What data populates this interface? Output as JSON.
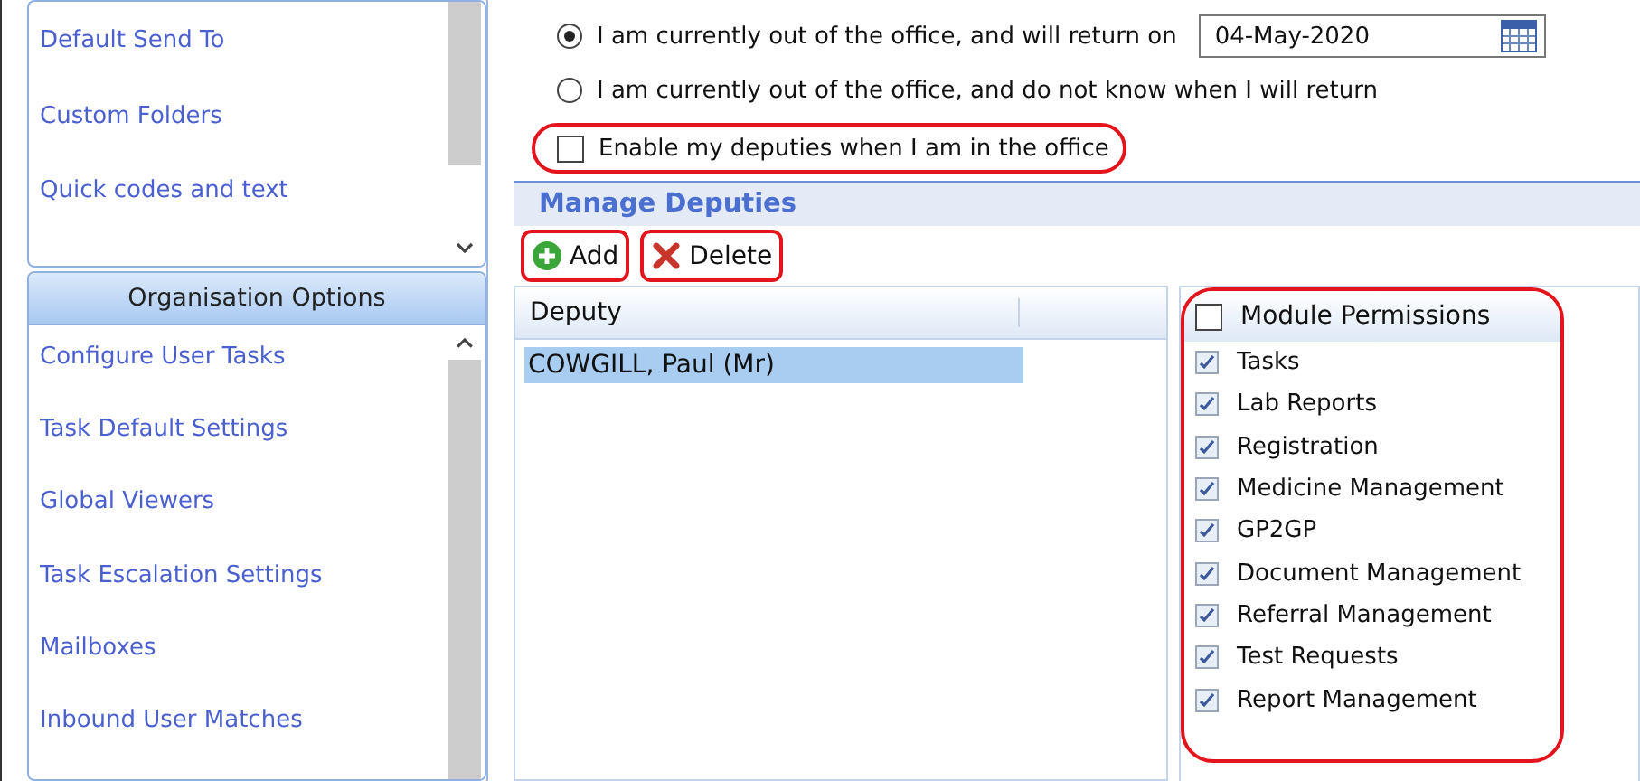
{
  "sidebar": {
    "sections": [
      {
        "items": [
          {
            "label": "Default Send To"
          },
          {
            "label": "Custom Folders"
          },
          {
            "label": "Quick codes and text"
          }
        ]
      },
      {
        "title": "Organisation Options",
        "items": [
          {
            "label": "Configure User Tasks"
          },
          {
            "label": "Task Default Settings"
          },
          {
            "label": "Global Viewers"
          },
          {
            "label": "Task Escalation Settings"
          },
          {
            "label": "Mailboxes"
          },
          {
            "label": "Inbound User Matches"
          }
        ]
      }
    ]
  },
  "return_options": [
    {
      "label": "I am currently out of the office, and will return on",
      "selected": true,
      "date": "04-May-2020"
    },
    {
      "label": "I am currently out of the office, and do not know when I will return",
      "selected": false
    }
  ],
  "enable_deputies": {
    "label": "Enable my deputies when I am in the office",
    "checked": false,
    "highlighted": true
  },
  "manage_deputies": {
    "title": "Manage Deputies",
    "buttons": [
      {
        "label": "Add",
        "kind": "add",
        "highlighted": true
      },
      {
        "label": "Delete",
        "kind": "delete",
        "highlighted": true
      }
    ]
  },
  "deputies_table": {
    "columns": [
      "Deputy"
    ],
    "rows": [
      {
        "name": "COWGILL, Paul (Mr)",
        "selected": true
      }
    ]
  },
  "permissions": {
    "highlighted": true,
    "header": {
      "label": "Module Permissions",
      "checked": false
    },
    "items": [
      {
        "label": "Tasks",
        "checked": true
      },
      {
        "label": "Lab Reports",
        "checked": true
      },
      {
        "label": "Registration",
        "checked": true
      },
      {
        "label": "Medicine Management",
        "checked": true
      },
      {
        "label": "GP2GP",
        "checked": true
      },
      {
        "label": "Document Management",
        "checked": true
      },
      {
        "label": "Referral Management",
        "checked": true
      },
      {
        "label": "Test Requests",
        "checked": true
      },
      {
        "label": "Report Management",
        "checked": true
      }
    ]
  }
}
